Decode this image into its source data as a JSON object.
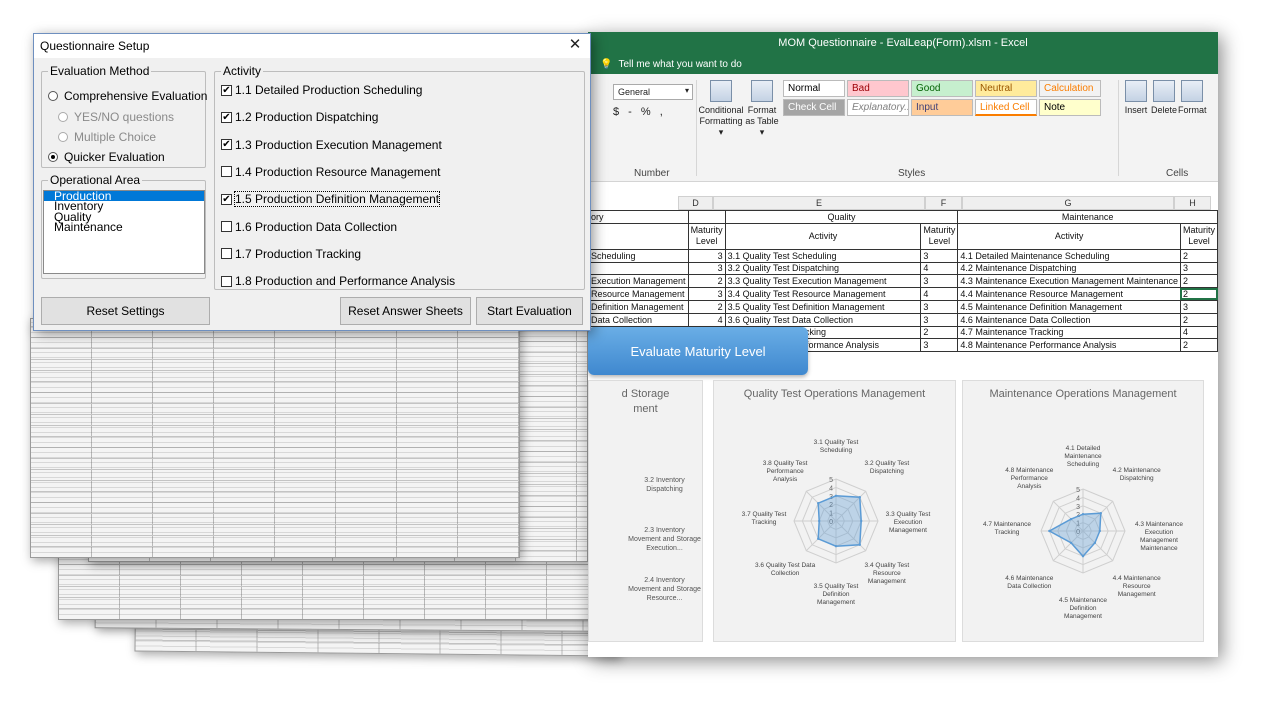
{
  "excel": {
    "title": "MOM Questionnaire - EvalLeap(Form).xlsm  -  Excel",
    "tell_me": "Tell me what you want to do",
    "number_format": "General",
    "number_row": "$ - % ,",
    "groups": {
      "number": "Number",
      "styles": "Styles",
      "cells": "Cells"
    },
    "buttons": {
      "conditional": "Conditional Formatting ▾",
      "format_table": "Format as Table ▾",
      "insert": "Insert",
      "delete": "Delete",
      "format": "Format"
    },
    "styles": [
      {
        "label": "Normal",
        "bg": "#ffffff",
        "fg": "#000000"
      },
      {
        "label": "Bad",
        "bg": "#ffc7ce",
        "fg": "#9c0006"
      },
      {
        "label": "Good",
        "bg": "#c6efce",
        "fg": "#006100"
      },
      {
        "label": "Neutral",
        "bg": "#ffeb9c",
        "fg": "#9c5700"
      },
      {
        "label": "Calculation",
        "bg": "#f2f2f2",
        "fg": "#fa7d00"
      },
      {
        "label": "Check Cell",
        "bg": "#a5a5a5",
        "fg": "#ffffff"
      },
      {
        "label": "Explanatory...",
        "bg": "#ffffff",
        "fg": "#7f7f7f"
      },
      {
        "label": "Input",
        "bg": "#ffcc99",
        "fg": "#3f3f76"
      },
      {
        "label": "Linked Cell",
        "bg": "#ffffff",
        "fg": "#fa7d00"
      },
      {
        "label": "Note",
        "bg": "#ffffcc",
        "fg": "#000000"
      }
    ],
    "columns": [
      "D",
      "E",
      "F",
      "G",
      "H"
    ],
    "table": {
      "group_headers": {
        "left": "ory",
        "quality": "Quality",
        "maintenance": "Maintenance"
      },
      "sub_headers": {
        "maturity_level": "Maturity Level",
        "activity": "Activity"
      },
      "rows": [
        {
          "prev": "Scheduling",
          "pl": "3",
          "q": "3.1 Quality Test Scheduling",
          "ql": "3",
          "m": "4.1 Detailed Maintenance Scheduling",
          "ml": "2"
        },
        {
          "prev": "",
          "pl": "3",
          "q": "3.2 Quality Test Dispatching",
          "ql": "4",
          "m": "4.2 Maintenance Dispatching",
          "ml": "3"
        },
        {
          "prev": "Execution Management",
          "pl": "2",
          "q": "3.3 Quality Test Execution Management",
          "ql": "3",
          "m": "4.3 Maintenance Execution Management Maintenance",
          "ml": "2"
        },
        {
          "prev": "Resource Management",
          "pl": "3",
          "q": "3.4 Quality Test Resource Management",
          "ql": "4",
          "m": "4.4 Maintenance Resource Management",
          "ml": "2"
        },
        {
          "prev": "Definition Management",
          "pl": "2",
          "q": "3.5 Quality Test Definition Management",
          "ql": "3",
          "m": "4.5 Maintenance Definition Management",
          "ml": "3"
        },
        {
          "prev": "Data Collection",
          "pl": "4",
          "q": "3.6 Quality Test Data Collection",
          "ql": "3",
          "m": "4.6 Maintenance Data Collection",
          "ml": "2"
        },
        {
          "prev": "Tracking",
          "pl": "2",
          "q": "3.7 Quality Test Tracking",
          "ql": "2",
          "m": "4.7 Maintenance Tracking",
          "ml": "4"
        },
        {
          "prev": "Performance Analysis",
          "pl": "2",
          "q": "3.8 Quality Test Performance Analysis",
          "ql": "3",
          "m": "4.8 Maintenance Performance Analysis",
          "ml": "2"
        }
      ]
    },
    "evaluate_button": "Evaluate Maturity Level"
  },
  "chart_data": [
    {
      "type": "radar",
      "title": "d Storage\nment",
      "categories": [
        "3.2 Inventory Dispatching",
        "2.3 Inventory Movement and Storage Execution...",
        "2.4 Inventory Movement and Storage Resource..."
      ],
      "note": "partially visible, values not readable"
    },
    {
      "type": "radar",
      "title": "Quality Test Operations Management",
      "categories": [
        "3.1 Quality Test Scheduling",
        "3.2 Quality Test Dispatching",
        "3.3 Quality Test Execution Management",
        "3.4 Quality Test Resource Management",
        "3.5 Quality Test Definition Management",
        "3.6 Quality Test Data Collection",
        "3.7 Quality Test Tracking",
        "3.8 Quality Test Performance Analysis"
      ],
      "values": [
        3,
        4,
        3,
        4,
        3,
        3,
        2,
        3
      ],
      "ticks": [
        "0",
        "1",
        "2",
        "3",
        "4",
        "5"
      ],
      "rlim": [
        0,
        5
      ],
      "color": "#5b9bd5"
    },
    {
      "type": "radar",
      "title": "Maintenance Operations Management",
      "categories": [
        "4.1 Detailed Maintenance Scheduling",
        "4.2 Maintenance Dispatching",
        "4.3 Maintenance Execution Management Maintenance",
        "4.4 Maintenance Resource Management",
        "4.5 Maintenance Definition Management",
        "4.6 Maintenance Data Collection",
        "4.7 Maintenance Tracking",
        "4.8 Maintenance Performance Analysis"
      ],
      "values": [
        2,
        3,
        2,
        2,
        3,
        2,
        4,
        2
      ],
      "ticks": [
        "0",
        "1",
        "2",
        "3",
        "4",
        "5"
      ],
      "rlim": [
        0,
        5
      ],
      "color": "#5b9bd5"
    }
  ],
  "dialog": {
    "title": "Questionnaire Setup",
    "close": "✕",
    "evaluation_method": {
      "legend": "Evaluation Method",
      "options": [
        {
          "label": "Comprehensive Evaluation",
          "selected": false,
          "enabled": true
        },
        {
          "label": "YES/NO questions",
          "selected": false,
          "enabled": false
        },
        {
          "label": "Multiple Choice",
          "selected": false,
          "enabled": false
        },
        {
          "label": "Quicker Evaluation",
          "selected": true,
          "enabled": true
        }
      ]
    },
    "operational_area": {
      "legend": "Operational Area",
      "items": [
        "Production",
        "Inventory",
        "Quality",
        "Maintenance"
      ],
      "selected": "Production"
    },
    "activity": {
      "legend": "Activity",
      "items": [
        {
          "label": "1.1 Detailed Production Scheduling",
          "checked": true
        },
        {
          "label": "1.2 Production Dispatching",
          "checked": true
        },
        {
          "label": "1.3 Production Execution Management",
          "checked": true
        },
        {
          "label": "1.4 Production Resource Management",
          "checked": false
        },
        {
          "label": "1.5 Production Definition Management",
          "checked": true
        },
        {
          "label": "1.6 Production Data Collection",
          "checked": false
        },
        {
          "label": "1.7 Production Tracking",
          "checked": false
        },
        {
          "label": "1.8 Production and Performance Analysis",
          "checked": false
        }
      ]
    },
    "buttons": {
      "reset_settings": "Reset Settings",
      "reset_answer_sheets": "Reset Answer Sheets",
      "start_evaluation": "Start Evaluation"
    }
  }
}
